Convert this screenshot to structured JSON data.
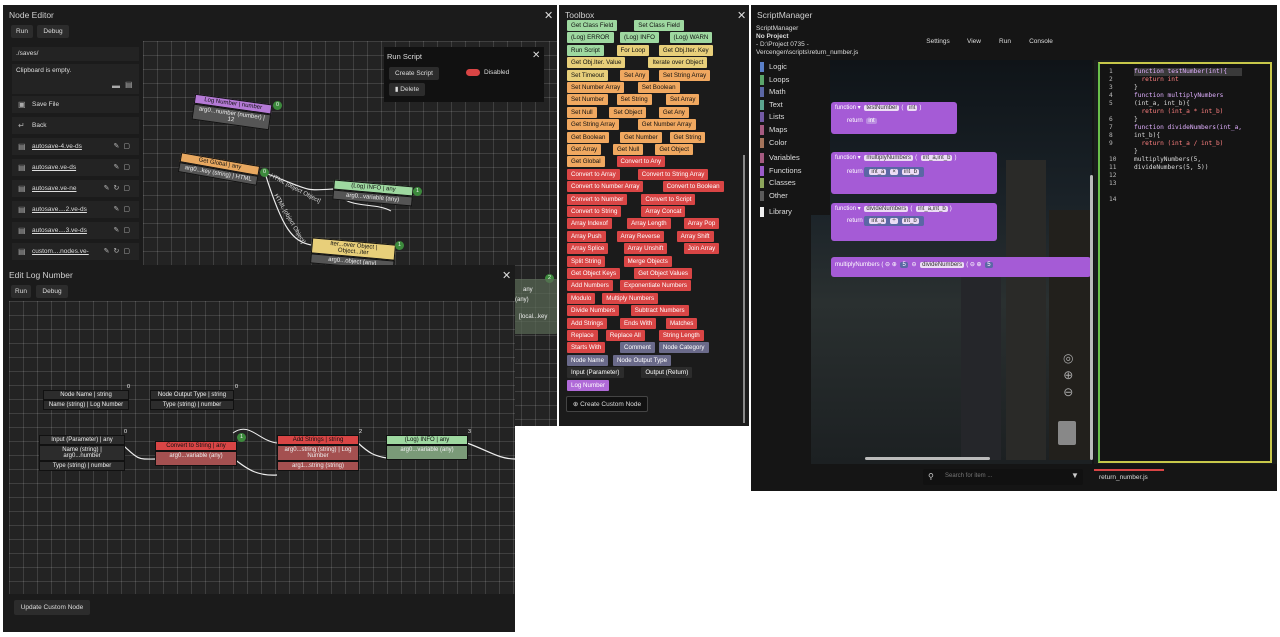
{
  "node_editor": {
    "title": "Node Editor",
    "run": "Run",
    "debug": "Debug",
    "path": "./saves/",
    "clipboard": "Clipboard is empty.",
    "save_file": "Save File",
    "back": "Back",
    "files": [
      "autosave-4.ve-ds",
      "autosave.ve-ds",
      "autosave.ve-ne",
      "autosave....2.ve-ds",
      "autosave....3.ve-ds",
      "custom....nodes.ve-"
    ],
    "nodes": {
      "log_number": "Log Number | number",
      "log_number_p": "arg0...number (number) | 12",
      "get_global": "Get Global | any",
      "get_global_p": "arg0...key (string) | HTML",
      "log_info": "(Log) INFO | any",
      "log_info_p": "arg0...variable (any)",
      "iter_obj": "Iter...over Object | Object...iter",
      "iter_obj_p": "arg0...object (any)",
      "edge1": "HTML [object Object]",
      "edge2": "HTML [object Object]",
      "side1": "any",
      "side2": "(any)",
      "side3": "[local...key"
    },
    "badges": [
      "0",
      "0",
      "1",
      "1",
      "2"
    ]
  },
  "run_script": {
    "title": "Run Script",
    "create": "Create Script",
    "status": "Disabled",
    "delete": "Delete"
  },
  "edit_log": {
    "title": "Edit Log Number",
    "run": "Run",
    "debug": "Debug",
    "update": "Update Custom Node",
    "nodes": {
      "node_name": "Node Name | string",
      "node_name_p": "Name (string) | Log Number",
      "node_out": "Node Output Type | string",
      "node_out_p": "Type (string) | number",
      "input_param": "Input (Parameter) | any",
      "input_p1": "Name (string) | arg0...number",
      "input_p2": "Type (string) | number",
      "convert": "Convert to String | any",
      "convert_p": "arg0...variable (any)",
      "add_str": "Add Strings | string",
      "add_p1": "arg0...string (string) | Log Number",
      "add_p2": "arg1...string (string)",
      "log_info": "(Log) INFO | any",
      "log_info_p": "arg0...variable (any)"
    },
    "badges": [
      "0",
      "0",
      "0",
      "1",
      "2",
      "3"
    ]
  },
  "toolbox": {
    "title": "Toolbox",
    "create": "Create Custom Node",
    "rows": [
      [
        {
          "t": "Get Class Field",
          "c": "#9ed8a0"
        },
        {
          "t": "Set Class Field",
          "c": "#9ed8a0"
        }
      ],
      [
        {
          "t": "(Log) ERROR",
          "c": "#9ed8a0"
        },
        {
          "t": "(Log) INFO",
          "c": "#9ed8a0"
        },
        {
          "t": "(Log) WARN",
          "c": "#9ed8a0"
        }
      ],
      [
        {
          "t": "Run Script",
          "c": "#9ed8a0"
        },
        {
          "t": "For Loop",
          "c": "#e8cf7a"
        },
        {
          "t": "Get Obj.Iter. Key",
          "c": "#e8cf7a"
        }
      ],
      [
        {
          "t": "Get Obj.Iter. Value",
          "c": "#e8cf7a"
        },
        {
          "t": "Iterate over Object",
          "c": "#e8cf7a"
        }
      ],
      [
        {
          "t": "Set Timeout",
          "c": "#e8cf7a"
        },
        {
          "t": "Set Any",
          "c": "#f0a860"
        },
        {
          "t": "Set String Array",
          "c": "#f0a860"
        }
      ],
      [
        {
          "t": "Set Number Array",
          "c": "#f0a860"
        },
        {
          "t": "Set Boolean",
          "c": "#f0a860"
        }
      ],
      [
        {
          "t": "Set Number",
          "c": "#f0a860"
        },
        {
          "t": "Set String",
          "c": "#f0a860"
        },
        {
          "t": "Set Array",
          "c": "#f0a860"
        }
      ],
      [
        {
          "t": "Set Null",
          "c": "#f0a860"
        },
        {
          "t": "Set Object",
          "c": "#f0a860"
        },
        {
          "t": "Get Any",
          "c": "#f0a860"
        }
      ],
      [
        {
          "t": "Get String Array",
          "c": "#f0a860"
        },
        {
          "t": "Get Number Array",
          "c": "#f0a860"
        }
      ],
      [
        {
          "t": "Get Boolean",
          "c": "#f0a860"
        },
        {
          "t": "Get Number",
          "c": "#f0a860"
        },
        {
          "t": "Get String",
          "c": "#f0a860"
        }
      ],
      [
        {
          "t": "Get Array",
          "c": "#f0a860"
        },
        {
          "t": "Get Null",
          "c": "#f0a860"
        },
        {
          "t": "Get Object",
          "c": "#f0a860"
        }
      ],
      [
        {
          "t": "Get Global",
          "c": "#f0a860"
        },
        {
          "t": "Convert to Any",
          "c": "#d94545"
        }
      ],
      [
        {
          "t": "Convert to Array",
          "c": "#d94545"
        },
        {
          "t": "Convert to String Array",
          "c": "#d94545"
        }
      ],
      [
        {
          "t": "Convert to Number Array",
          "c": "#d94545"
        },
        {
          "t": "Convert to Boolean",
          "c": "#d94545"
        }
      ],
      [
        {
          "t": "Convert to Number",
          "c": "#d94545"
        },
        {
          "t": "Convert to Script",
          "c": "#d94545"
        }
      ],
      [
        {
          "t": "Convert to String",
          "c": "#d94545"
        },
        {
          "t": "Array Concat",
          "c": "#d94545"
        }
      ],
      [
        {
          "t": "Array Indexof",
          "c": "#d94545"
        },
        {
          "t": "Array Length",
          "c": "#d94545"
        },
        {
          "t": "Array Pop",
          "c": "#d94545"
        }
      ],
      [
        {
          "t": "Array Push",
          "c": "#d94545"
        },
        {
          "t": "Array Reverse",
          "c": "#d94545"
        },
        {
          "t": "Array Shift",
          "c": "#d94545"
        }
      ],
      [
        {
          "t": "Array Splice",
          "c": "#d94545"
        },
        {
          "t": "Array Unshift",
          "c": "#d94545"
        },
        {
          "t": "Join Array",
          "c": "#d94545"
        }
      ],
      [
        {
          "t": "Split String",
          "c": "#d94545"
        },
        {
          "t": "Merge Objects",
          "c": "#d94545"
        }
      ],
      [
        {
          "t": "Get Object Keys",
          "c": "#d94545"
        },
        {
          "t": "Get Object Values",
          "c": "#d94545"
        }
      ],
      [
        {
          "t": "Add Numbers",
          "c": "#d94545"
        },
        {
          "t": "Exponentiate Numbers",
          "c": "#d94545"
        }
      ],
      [
        {
          "t": "Modulo",
          "c": "#d94545"
        },
        {
          "t": "Multiply Numbers",
          "c": "#d94545"
        }
      ],
      [
        {
          "t": "Divide Numbers",
          "c": "#d94545"
        },
        {
          "t": "Subtract Numbers",
          "c": "#d94545"
        }
      ],
      [
        {
          "t": "Add Strings",
          "c": "#d94545"
        },
        {
          "t": "Ends With",
          "c": "#d94545"
        },
        {
          "t": "Matches",
          "c": "#d94545"
        }
      ],
      [
        {
          "t": "Replace",
          "c": "#d94545"
        },
        {
          "t": "Replace All",
          "c": "#d94545"
        },
        {
          "t": "String Length",
          "c": "#d94545"
        }
      ],
      [
        {
          "t": "Starts With",
          "c": "#d94545"
        },
        {
          "t": "Comment",
          "c": "#6a6a8a"
        },
        {
          "t": "Node Category",
          "c": "#6a6a8a"
        }
      ],
      [
        {
          "t": "Node Name",
          "c": "#6a6a8a"
        },
        {
          "t": "Node Output Type",
          "c": "#6a6a8a"
        }
      ],
      [
        {
          "t": "Input (Parameter)",
          "c": "#2c2c2c"
        },
        {
          "t": "Output (Return)",
          "c": "#2c2c2c"
        }
      ],
      [
        {
          "t": "Log Number",
          "c": "#b06ad8"
        }
      ]
    ]
  },
  "script_manager": {
    "title": "ScriptManager",
    "app": "ScriptManager",
    "project": "No Project",
    "path1": "- D:\\Project 0735 -",
    "path2": "Vercengen\\scripts\\return_number.js",
    "menu": [
      "Settings",
      "View",
      "Run",
      "Console"
    ],
    "categories": [
      {
        "t": "Logic",
        "c": "#5b80c8"
      },
      {
        "t": "Loops",
        "c": "#5ba56b"
      },
      {
        "t": "Math",
        "c": "#5b67a5"
      },
      {
        "t": "Text",
        "c": "#5ba58f"
      },
      {
        "t": "Lists",
        "c": "#745ba5"
      },
      {
        "t": "Maps",
        "c": "#a55b80"
      },
      {
        "t": "Color",
        "c": "#a5745b"
      },
      {
        "t": "Variables",
        "c": "#a55b80"
      },
      {
        "t": "Functions",
        "c": "#9a5bc8"
      },
      {
        "t": "Classes",
        "c": "#8ca55b"
      },
      {
        "t": "Other",
        "c": "#5b5b5b"
      },
      {
        "t": "Library",
        "c": "#eeeeee"
      }
    ],
    "blocks": {
      "function": "function",
      "return": "return",
      "testNumber": "testNumber",
      "int": "int",
      "multiplyNumbers": "multiplyNumbers",
      "int_a_b": "int_a,int_b",
      "int_a": "int_a",
      "int_b": "int_b",
      "times": "×",
      "divideNumbers": "divideNumbers",
      "divide": "÷",
      "five": "5"
    },
    "search_placeholder": "Search for item ...",
    "file_tab": "return_number.js",
    "lines": [
      "1",
      "2",
      "3",
      "4",
      "5",
      "6",
      "7",
      "8",
      "9",
      "10",
      "11",
      "12",
      "13",
      "14"
    ],
    "code": [
      "function testNumber(int){",
      "  return int",
      "}",
      "",
      "function multiplyNumbers",
      "(int_a, int_b){",
      "  return (int_a * int_b)",
      "}",
      "",
      "function divideNumbers(int_a,",
      "int_b){",
      "  return (int_a / int_b)",
      "}",
      "",
      "multiplyNumbers(5,",
      "divideNumbers(5, 5))"
    ]
  },
  "colors": {
    "accent_yellow": "#c8c84a",
    "accent_green": "#6abf4b"
  }
}
